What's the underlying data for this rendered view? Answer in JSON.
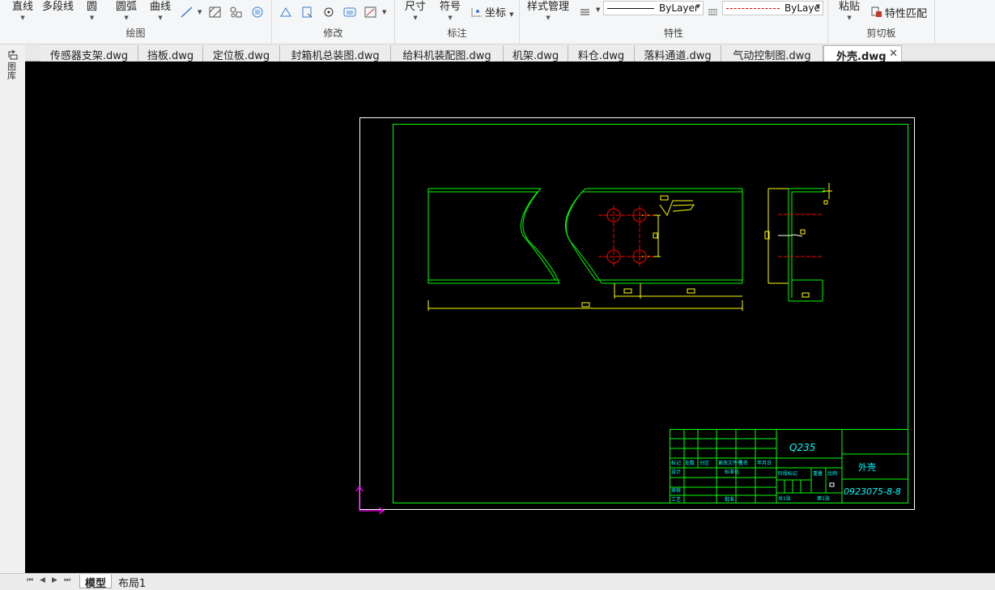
{
  "ribbon": {
    "draw": {
      "line": "直线",
      "polyline": "多段线",
      "circle": "圆",
      "arc": "圆弧",
      "curve": "曲线",
      "label": "绘图"
    },
    "modify": {
      "label": "修改"
    },
    "annotate": {
      "dimension": "尺寸",
      "symbol": "符号",
      "coordinate": "坐标",
      "label": "标注"
    },
    "properties": {
      "style_manager": "样式管理",
      "linetype_value": "ByLayer",
      "linecolor_value": "ByLaye",
      "label": "特性"
    },
    "clipboard": {
      "paste": "粘贴",
      "match_properties": "特性匹配",
      "label": "剪切板"
    }
  },
  "tabs": [
    "传感器支架.dwg",
    "挡板.dwg",
    "定位板.dwg",
    "封箱机总装图.dwg",
    "给料机装配图.dwg",
    "机架.dwg",
    "料仓.dwg",
    "落料通道.dwg",
    "气动控制图.dwg",
    "外壳.dwg"
  ],
  "active_tab_index": 9,
  "side_panel": {
    "label": "图库"
  },
  "drawing": {
    "material": "Q235",
    "part_name": "外壳",
    "drawing_number": "0923075-8-8",
    "tb_mark": "标记",
    "tb_count": "处数",
    "tb_zone": "分区",
    "tb_change_doc": "更改文件号",
    "tb_sign": "签名",
    "tb_date": "年月日",
    "tb_design": "设计",
    "tb_standard": "标准化",
    "tb_stage": "阶段标记",
    "tb_weight": "重量",
    "tb_scale": "比例",
    "tb_review": "审核",
    "tb_process": "工艺",
    "tb_approve": "批准",
    "tb_total_sheets": "共1张",
    "tb_sheet": "第1张"
  },
  "layout_tabs": {
    "model": "模型",
    "layout1": "布局1"
  },
  "colors": {
    "green": "#00ff00",
    "yellow": "#ffff00",
    "red": "#ff0000",
    "cyan": "#00ffff",
    "magenta": "#ff00ff"
  }
}
